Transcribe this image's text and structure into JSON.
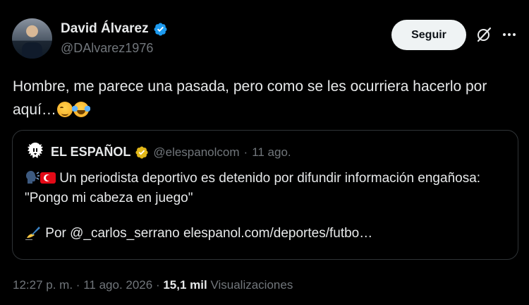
{
  "author": {
    "display_name": "David Álvarez",
    "handle": "@DAlvarez1976",
    "avatar": "avatar-photo"
  },
  "actions": {
    "follow_label": "Seguir",
    "grok_icon": "grok-icon",
    "more_icon": "more-dots-icon"
  },
  "tweet": {
    "text": "Hombre, me parece una pasada, pero como se les ocurriera hacerlo por aquí…",
    "emojis": [
      "smirking-face-emoji",
      "tears-of-joy-emoji"
    ]
  },
  "quote": {
    "name": "EL ESPAÑOL",
    "handle": "@elespanolcom",
    "separator": "·",
    "date": "11 ago.",
    "headline": "Un periodista deportivo es detenido por difundir información engañosa: \"Pongo mi cabeza en juego\"",
    "by_prefix": "Por",
    "by_mention": "@_carlos_serrano",
    "link": "elespanol.com/deportes/futbo…"
  },
  "meta": {
    "time": "12:27 p. m.",
    "sep": "·",
    "date": "11 ago. 2026",
    "views_count": "15,1 mil",
    "views_label": "Visualizaciones"
  },
  "colors": {
    "background": "#000000",
    "text": "#e7e9ea",
    "muted": "#71767b",
    "verified_blue": "#1d9bf0",
    "verified_gold": "#e2b719",
    "border": "#2f3336"
  }
}
